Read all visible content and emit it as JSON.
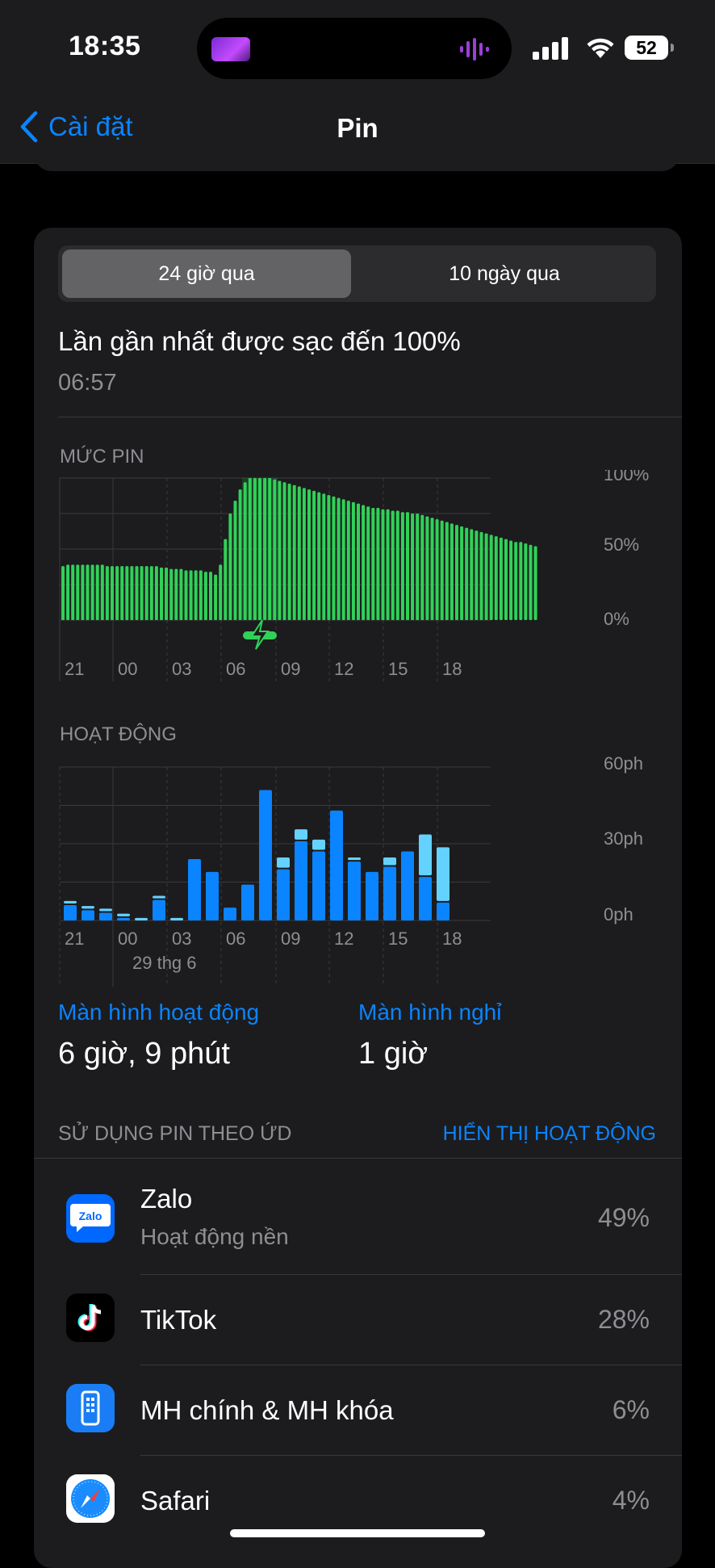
{
  "status_bar": {
    "time": "18:35",
    "battery": "52",
    "icons": [
      "signal-icon",
      "wifi-icon",
      "battery-icon"
    ]
  },
  "nav": {
    "back_label": "Cài đặt",
    "title": "Pin"
  },
  "segmented": {
    "options": [
      "24 giờ qua",
      "10 ngày qua"
    ],
    "selected": "24 giờ qua"
  },
  "last_charge": {
    "label": "Lần gần nhất được sạc đến 100%",
    "time": "06:57"
  },
  "battery_chart": {
    "title": "MỨC PIN",
    "y_labels": [
      "100%",
      "50%",
      "0%"
    ],
    "x_labels": [
      "21",
      "00",
      "03",
      "06",
      "09",
      "12",
      "15",
      "18"
    ]
  },
  "activity_chart": {
    "title": "HOẠT ĐỘNG",
    "y_labels": [
      "60ph",
      "30ph",
      "0ph"
    ],
    "x_labels": [
      "21",
      "00",
      "03",
      "06",
      "09",
      "12",
      "15",
      "18"
    ],
    "date_label": "29 thg 6"
  },
  "chart_data": [
    {
      "type": "bar",
      "title": "MỨC PIN",
      "ylim": [
        0,
        100
      ],
      "unit": "%",
      "x_ticks": [
        "21",
        "00",
        "03",
        "06",
        "09",
        "12",
        "15",
        "18"
      ],
      "charging_window": [
        5.7,
        6.9
      ],
      "charging_icon": "lightning-icon",
      "values": [
        38,
        39,
        39,
        39,
        39,
        39,
        39,
        39,
        39,
        38,
        38,
        38,
        38,
        38,
        38,
        38,
        38,
        38,
        38,
        38,
        37,
        37,
        36,
        36,
        36,
        35,
        35,
        35,
        35,
        34,
        34,
        32,
        39,
        57,
        75,
        84,
        92,
        97,
        100,
        100,
        100,
        100,
        100,
        99,
        98,
        97,
        96,
        95,
        94,
        93,
        92,
        91,
        90,
        89,
        88,
        87,
        86,
        85,
        84,
        83,
        82,
        81,
        80,
        79,
        79,
        78,
        78,
        77,
        77,
        76,
        76,
        75,
        75,
        74,
        73,
        72,
        71,
        70,
        69,
        68,
        67,
        66,
        65,
        64,
        63,
        62,
        61,
        60,
        59,
        58,
        57,
        56,
        55,
        55,
        54,
        53,
        52
      ],
      "color": "#30d158"
    },
    {
      "type": "bar",
      "title": "HOẠT ĐỘNG",
      "ylim": [
        0,
        60
      ],
      "unit": "ph",
      "x_ticks": [
        "21",
        "00",
        "03",
        "06",
        "09",
        "12",
        "15",
        "18"
      ],
      "categories": [
        "21",
        "22",
        "23",
        "00",
        "01",
        "02",
        "03",
        "04",
        "05",
        "06",
        "07",
        "08",
        "09",
        "10",
        "11",
        "12",
        "13",
        "14",
        "15",
        "16",
        "17",
        "18"
      ],
      "series": [
        {
          "name": "Màn hình hoạt động",
          "color": "#0a84ff",
          "values": [
            6,
            4,
            3,
            1,
            0,
            8,
            0,
            24,
            19,
            5,
            14,
            51,
            20,
            31,
            27,
            43,
            23,
            19,
            21,
            27,
            17,
            7
          ]
        },
        {
          "name": "Màn hình nghỉ",
          "color": "#64d2ff",
          "values": [
            1,
            1,
            1,
            1,
            1,
            1,
            1,
            0,
            0,
            0,
            0,
            0,
            4,
            4,
            4,
            0,
            1,
            0,
            3,
            0,
            16,
            21
          ]
        }
      ]
    }
  ],
  "screen_stats": {
    "active": {
      "label": "Màn hình hoạt động",
      "value": "6 giờ, 9 phút"
    },
    "idle": {
      "label": "Màn hình nghỉ",
      "value": "1 giờ"
    }
  },
  "usage": {
    "header": "SỬ DỤNG PIN THEO ỨD",
    "link": "HIỂN THỊ HOẠT ĐỘNG",
    "apps": [
      {
        "name": "Zalo",
        "sub": "Hoạt động nền",
        "percent": "49%",
        "icon": "zalo-icon"
      },
      {
        "name": "TikTok",
        "sub": "",
        "percent": "28%",
        "icon": "tiktok-icon"
      },
      {
        "name": "MH chính & MH khóa",
        "sub": "",
        "percent": "6%",
        "icon": "home-lock-screen-icon"
      },
      {
        "name": "Safari",
        "sub": "",
        "percent": "4%",
        "icon": "safari-icon"
      }
    ]
  }
}
